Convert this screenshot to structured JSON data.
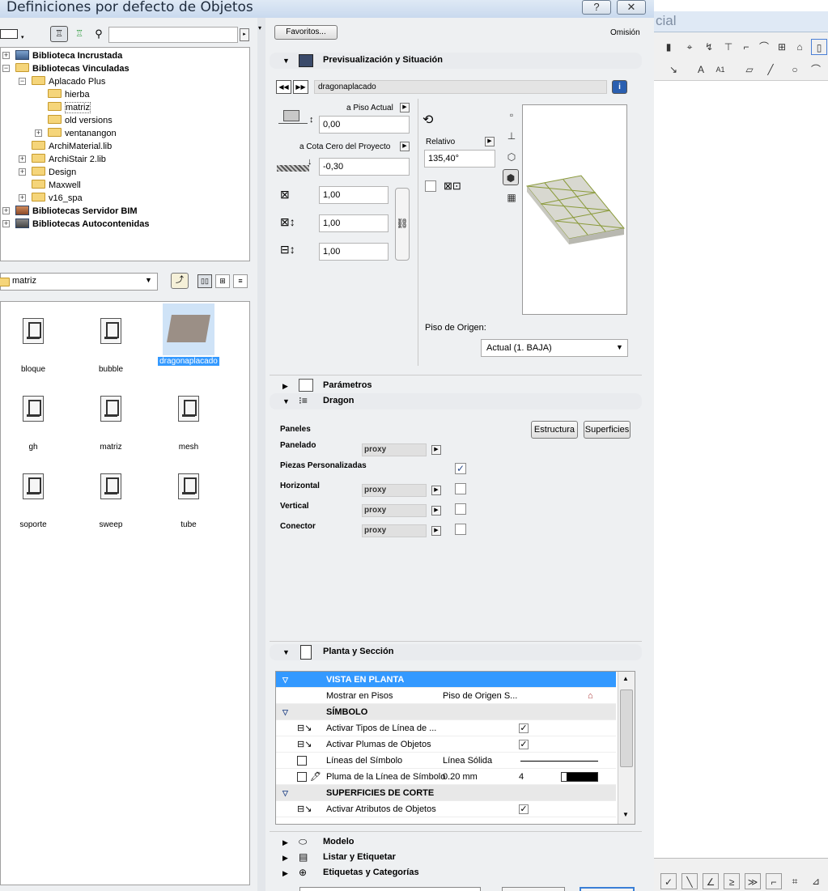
{
  "window": {
    "title": "Definiciones por defecto de Objetos",
    "help_label": "?",
    "close_label": "✕"
  },
  "bg_app": {
    "title_fragment": "cial"
  },
  "toolbar": {
    "search_placeholder": "",
    "favorites_label": "Favoritos...",
    "default_label": "Omisión"
  },
  "tree": {
    "items": [
      {
        "label": "Biblioteca Incrustada",
        "bold": true
      },
      {
        "label": "Bibliotecas Vinculadas",
        "bold": true
      },
      {
        "label": "Aplacado Plus"
      },
      {
        "label": "hierba"
      },
      {
        "label": "matriz"
      },
      {
        "label": "old versions"
      },
      {
        "label": "ventanangon"
      },
      {
        "label": "ArchiMaterial.lib"
      },
      {
        "label": "ArchiStair 2.lib"
      },
      {
        "label": "Design"
      },
      {
        "label": "Maxwell"
      },
      {
        "label": "v16_spa"
      },
      {
        "label": "Bibliotecas Servidor BIM",
        "bold": true
      },
      {
        "label": "Bibliotecas Autocontenidas",
        "bold": true
      }
    ]
  },
  "folder_combo": {
    "value": "matriz"
  },
  "objects": [
    {
      "label": "bloque"
    },
    {
      "label": "bubble"
    },
    {
      "label": "dragonaplacado"
    },
    {
      "label": "gh"
    },
    {
      "label": "matriz"
    },
    {
      "label": "mesh"
    },
    {
      "label": "soporte"
    },
    {
      "label": "sweep"
    },
    {
      "label": "tube"
    }
  ],
  "preview": {
    "section_title": "Previsualización y Situación",
    "object_name": "dragonaplacado",
    "info_label": "i",
    "floor_label": "a Piso Actual",
    "floor_value": "0,00",
    "proj_label": "a Cota Cero del Proyecto",
    "proj_value": "-0,30",
    "dim1": "1,00",
    "dim2": "1,00",
    "dim3": "1,00",
    "relative_label": "Relativo",
    "angle_value": "135,40°",
    "origin_label": "Piso de Origen:",
    "origin_value": "Actual (1. BAJA)"
  },
  "sections": {
    "parametros": "Parámetros",
    "dragon": "Dragon",
    "planta": "Planta y Sección",
    "modelo": "Modelo",
    "listar": "Listar y Etiquetar",
    "etiquetas": "Etiquetas y Categorías"
  },
  "dragon": {
    "paneles": "Paneles",
    "estructura": "Estructura",
    "superficies": "Superficies",
    "panelado": "Panelado",
    "panelado_val": "proxy",
    "piezas": "Piezas Personalizadas",
    "piezas_checked": "✓",
    "horizontal": "Horizontal",
    "horizontal_val": "proxy",
    "vertical": "Vertical",
    "vertical_val": "proxy",
    "conector": "Conector",
    "conector_val": "proxy"
  },
  "planta_list": {
    "rows": [
      {
        "name": "VISTA EN PLANTA",
        "value": "",
        "extra": "",
        "type": "selected"
      },
      {
        "name": "Mostrar en Pisos",
        "value": "Piso de Origen S...",
        "extra": "",
        "type": "row"
      },
      {
        "name": "SÍMBOLO",
        "value": "",
        "extra": "",
        "type": "header"
      },
      {
        "name": "Activar Tipos de Línea de ...",
        "value": "",
        "extra": "✓",
        "type": "row"
      },
      {
        "name": "Activar Plumas de Objetos",
        "value": "",
        "extra": "✓",
        "type": "row"
      },
      {
        "name": "Líneas del Símbolo",
        "value": "Línea Sólida",
        "extra": "",
        "type": "row"
      },
      {
        "name": "Pluma de la Línea de Símbolo",
        "value": "0.20 mm",
        "extra": "4",
        "type": "row"
      },
      {
        "name": "SUPERFICIES DE CORTE",
        "value": "",
        "extra": "",
        "type": "header"
      },
      {
        "name": "Activar Atributos de Objetos",
        "value": "",
        "extra": "✓",
        "type": "row"
      }
    ]
  }
}
